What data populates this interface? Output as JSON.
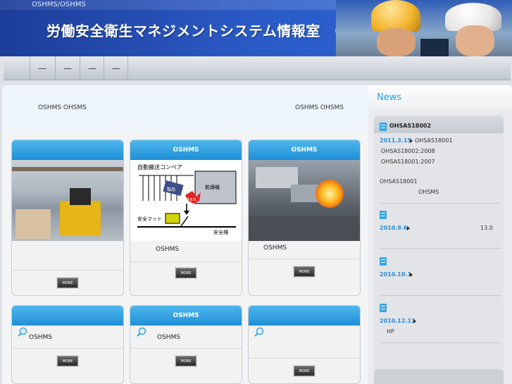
{
  "header": {
    "breadcrumb": "OSHMS/OSHMS",
    "title": "労働安全衛生マネジメントシステム情報室　OSHMS．jp"
  },
  "nav": {
    "items": [
      "—",
      "—",
      "—",
      "—"
    ]
  },
  "intro": {
    "left": "OSHMS OHSMS",
    "right": "OSHMS OHSMS"
  },
  "cards_row1": [
    {
      "head": "",
      "text": "",
      "more": "MORE"
    },
    {
      "head": "OSHMS",
      "text": "OSHMS",
      "more": "MORE"
    },
    {
      "head": "OSHMS",
      "text": "OSHMS",
      "more": "MORE"
    }
  ],
  "cards_row2": [
    {
      "head": "",
      "text": "OSHMS",
      "more": "MORE"
    },
    {
      "head": "OSHMS",
      "text": "OSHMS",
      "more": "MORE"
    },
    {
      "head": "",
      "text": "",
      "more": "MORE"
    }
  ],
  "diagram": {
    "conveyor": "自動搬送コンベア",
    "product": "製品",
    "dryer": "乾燥機",
    "hazard": "挟まれ",
    "mat": "安全マット",
    "fence": "安全柵"
  },
  "news": {
    "title": "News",
    "head": "OHSAS18002",
    "entries": [
      {
        "date": "2011.3.15",
        "lines": [
          "OHSAS18001",
          "OHSAS18002:2008",
          "OHSAS18001:2007"
        ]
      },
      {
        "date": "",
        "lines": [
          "OHSAS18001",
          "OHSMS"
        ]
      },
      {
        "date": "2010.9.6",
        "lines": [
          "13.0"
        ]
      },
      {
        "date": "2010.10.1",
        "lines": []
      },
      {
        "date": "2010.12.13",
        "lines": [
          "HP"
        ]
      }
    ]
  },
  "colors": {
    "header_bg": "#2a58c2",
    "card_head": "#1e8fd6",
    "news_title": "#2f9fe0",
    "date": "#2b8dd6"
  }
}
